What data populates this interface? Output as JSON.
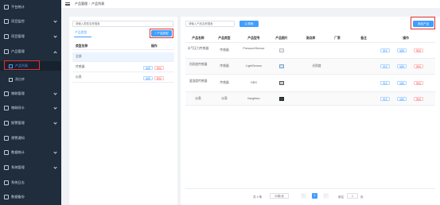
{
  "sidebar": {
    "items": [
      {
        "label": "平台统计",
        "icon": "home-icon"
      },
      {
        "label": "项目监控",
        "icon": "monitor-icon"
      },
      {
        "label": "项目管理",
        "icon": "folder-icon"
      },
      {
        "label": "产品管理",
        "icon": "product-icon"
      },
      {
        "label": "产品列表",
        "icon": "star-icon",
        "sub": true,
        "active": true
      },
      {
        "label": "测点库",
        "icon": "star-icon",
        "sub": true
      },
      {
        "label": "物联管理",
        "icon": "iot-icon"
      },
      {
        "label": "物联网卡",
        "icon": "sim-card-icon"
      },
      {
        "label": "报警管理",
        "icon": "alarm-icon"
      },
      {
        "label": "预警通知",
        "icon": "bell-icon"
      },
      {
        "label": "数据统计",
        "icon": "chart-icon"
      },
      {
        "label": "系统管理",
        "icon": "gear-icon"
      },
      {
        "label": "系统日志",
        "icon": "log-icon"
      },
      {
        "label": "数据备份",
        "icon": "backup-icon"
      }
    ]
  },
  "header": {
    "crumb_parent": "产品管理",
    "crumb_sep": "/",
    "crumb_current": "产品列表"
  },
  "left": {
    "search_placeholder": "请输入类型名称搜索",
    "tab_label": "产品类型",
    "add_type_button": "+ 产品类型",
    "columns": [
      "类型名称",
      "操作"
    ],
    "rows": [
      {
        "name": "全部",
        "actions": []
      },
      {
        "name": "传感器",
        "actions": [
          "编辑",
          "删除"
        ]
      },
      {
        "name": "仪表",
        "actions": [
          "编辑",
          "删除"
        ]
      }
    ]
  },
  "right": {
    "search_placeholder": "请输入产品名称搜索",
    "search_button": "Q 搜索",
    "add_button": "添加产品",
    "columns": [
      "产品名称",
      "产品类型",
      "产品型号",
      "产品图片",
      "测点库",
      "厂家",
      "备注",
      "操作"
    ],
    "rows": [
      {
        "name": "水气压力传感器",
        "type": "传感器",
        "model": "PressureSensor",
        "lib": "",
        "vendor": "",
        "remark": "",
        "actions": [
          "测点",
          "编辑",
          "删除"
        ]
      },
      {
        "name": "光照度传感器",
        "type": "传感器",
        "model": "LightSensor",
        "lib": "光照度",
        "vendor": "",
        "remark": "",
        "actions": [
          "测点",
          "编辑",
          "删除"
        ]
      },
      {
        "name": "温湿度传感器",
        "type": "传感器",
        "model": "DBS",
        "lib": "",
        "vendor": "",
        "remark": "",
        "actions": [
          "测点",
          "编辑",
          "删除"
        ]
      },
      {
        "name": "仪表",
        "type": "仪表",
        "model": "liangbiao",
        "lib": "",
        "vendor": "",
        "remark": "",
        "actions": [
          "测点",
          "编辑",
          "删除"
        ]
      }
    ],
    "pagination": {
      "total": "共 4 条",
      "page_size": "20条/页",
      "prev": "<",
      "current": "1",
      "next": ">",
      "goto_label": "前往",
      "goto_value": "1",
      "page_suffix": "页"
    }
  },
  "colors": {
    "accent": "#409eff",
    "sidebar": "#1f2d3d",
    "danger": "#f56c6c",
    "highlight": "#e53030"
  }
}
